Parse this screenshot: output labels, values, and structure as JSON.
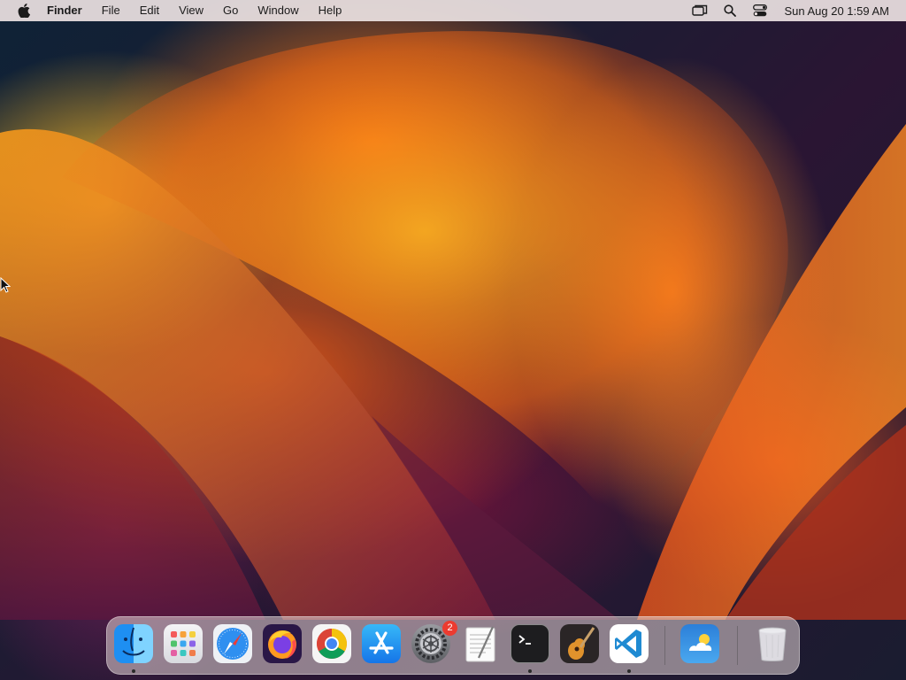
{
  "menubar": {
    "app_name": "Finder",
    "menus": [
      "File",
      "Edit",
      "View",
      "Go",
      "Window",
      "Help"
    ],
    "clock": "Sun Aug 20  1:59 AM",
    "status_icons": [
      "screen-mirroring-icon",
      "spotlight-search-icon",
      "control-center-icon"
    ]
  },
  "dock": {
    "apps": [
      {
        "name": "Finder",
        "icon": "finder-icon",
        "running": true
      },
      {
        "name": "Launchpad",
        "icon": "launchpad-icon",
        "running": false
      },
      {
        "name": "Safari",
        "icon": "safari-icon",
        "running": false
      },
      {
        "name": "Firefox",
        "icon": "firefox-icon",
        "running": false
      },
      {
        "name": "Google Chrome",
        "icon": "chrome-icon",
        "running": false
      },
      {
        "name": "App Store",
        "icon": "app-store-icon",
        "running": false
      },
      {
        "name": "System Settings",
        "icon": "system-settings-icon",
        "running": false,
        "badge": "2"
      },
      {
        "name": "TextEdit",
        "icon": "textedit-icon",
        "running": false
      },
      {
        "name": "Terminal",
        "icon": "terminal-icon",
        "running": true
      },
      {
        "name": "GarageBand",
        "icon": "garageband-icon",
        "running": false
      },
      {
        "name": "Visual Studio Code",
        "icon": "vscode-icon",
        "running": true
      },
      {
        "name": "Weather",
        "icon": "weather-icon",
        "running": false
      },
      {
        "name": "Trash",
        "icon": "trash-icon",
        "running": false
      }
    ]
  },
  "colors": {
    "badge": "#ec3b30",
    "menubar_bg": "#ece2e2"
  }
}
